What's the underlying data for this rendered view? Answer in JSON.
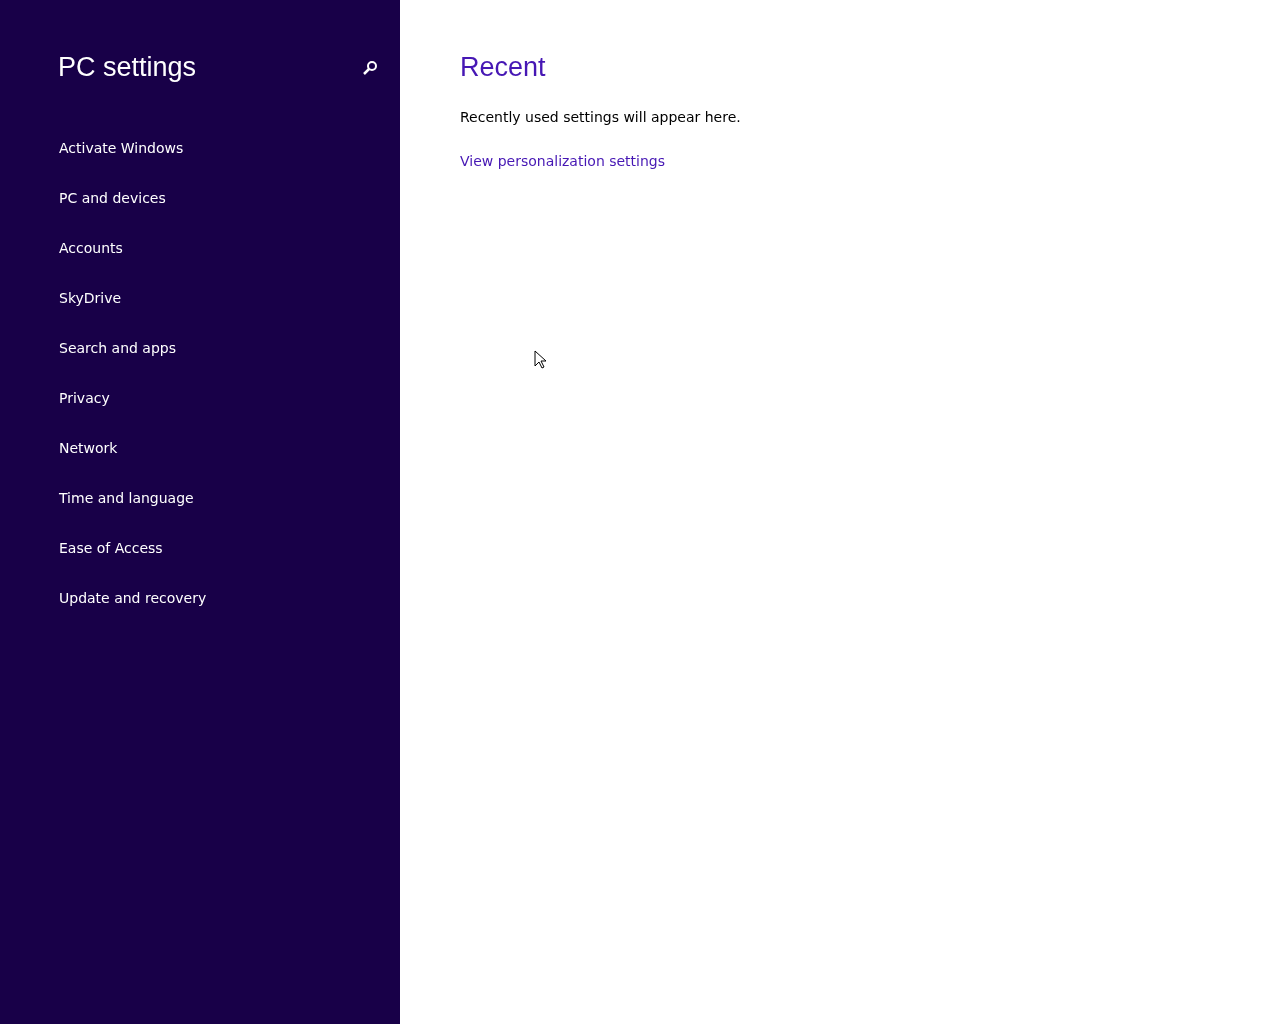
{
  "sidebar": {
    "title": "PC settings",
    "items": [
      {
        "label": "Activate Windows"
      },
      {
        "label": "PC and devices"
      },
      {
        "label": "Accounts"
      },
      {
        "label": "SkyDrive"
      },
      {
        "label": "Search and apps"
      },
      {
        "label": "Privacy"
      },
      {
        "label": "Network"
      },
      {
        "label": "Time and language"
      },
      {
        "label": "Ease of Access"
      },
      {
        "label": "Update and recovery"
      }
    ]
  },
  "content": {
    "title": "Recent",
    "message": "Recently used settings will appear here.",
    "link": "View personalization settings"
  }
}
